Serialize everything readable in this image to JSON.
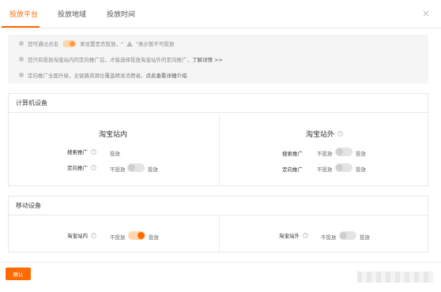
{
  "tabs": [
    {
      "label": "投放平台",
      "active": true
    },
    {
      "label": "投放地域",
      "active": false
    },
    {
      "label": "投放时间",
      "active": false
    }
  ],
  "close_glyph": "×",
  "info": {
    "line1_a": "您可通过点击",
    "line1_b": "来设置是否投放，\"",
    "line1_c": "\"表示暂不可投放",
    "line2_text": "您只有投放淘宝站内的定向推广后，才能选择投放淘宝站外的定向推广，",
    "line2_link": "了解详情 >>",
    "line3_text": "定向推广全面升级，全链路资源位覆盖精准消费者。",
    "line3_link": "点此查看详细介绍"
  },
  "computer": {
    "title": "计算机设备",
    "inside": {
      "title": "淘宝站内",
      "rows": [
        {
          "label": "搜索推广",
          "value": "投放"
        },
        {
          "label": "定向推广",
          "off_label": "不投放",
          "on_label": "投放",
          "state": "off"
        }
      ]
    },
    "outside": {
      "title": "淘宝站外",
      "rows": [
        {
          "label": "搜索推广",
          "off_label": "不投放",
          "on_label": "投放",
          "state": "off"
        },
        {
          "label": "定向推广",
          "off_label": "不投放",
          "on_label": "投放",
          "state": "off"
        }
      ]
    }
  },
  "mobile": {
    "title": "移动设备",
    "inside": {
      "label": "淘宝站内",
      "off_label": "不投放",
      "on_label": "投放",
      "state": "on"
    },
    "outside": {
      "label": "淘宝站外",
      "off_label": "不投放",
      "on_label": "投放",
      "state": "off"
    }
  },
  "footer": {
    "confirm_label": "确认"
  },
  "colors": {
    "accent": "#ff6a00",
    "toggle_on_track": "#ffd8b0",
    "toggle_off_track": "#e4e4e4"
  }
}
